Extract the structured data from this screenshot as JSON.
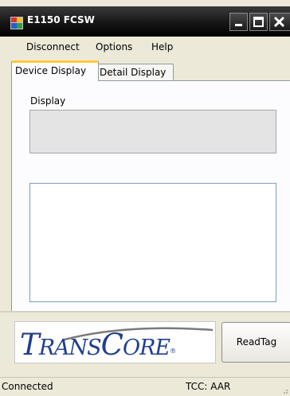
{
  "window": {
    "title": "E1150 FCSW"
  },
  "menu": {
    "items": [
      "Disconnect",
      "Options",
      "Help"
    ]
  },
  "tabs": [
    {
      "label": "Device Display",
      "active": true
    },
    {
      "label": "Detail Display",
      "active": false
    }
  ],
  "device_display": {
    "display_label": "Display",
    "display_value": ""
  },
  "logo": {
    "text_big_t": "T",
    "text_rans": "RANS",
    "text_big_c": "C",
    "text_ore": "ORE",
    "trademark": "®"
  },
  "buttons": {
    "read_tag": "ReadTag"
  },
  "status": {
    "connection": "Connected",
    "tcc": "TCC: AAR"
  },
  "colors": {
    "titlebar": "#000000",
    "tab_highlight": "#ffc83c",
    "logo_blue": "#1f3f8f"
  }
}
